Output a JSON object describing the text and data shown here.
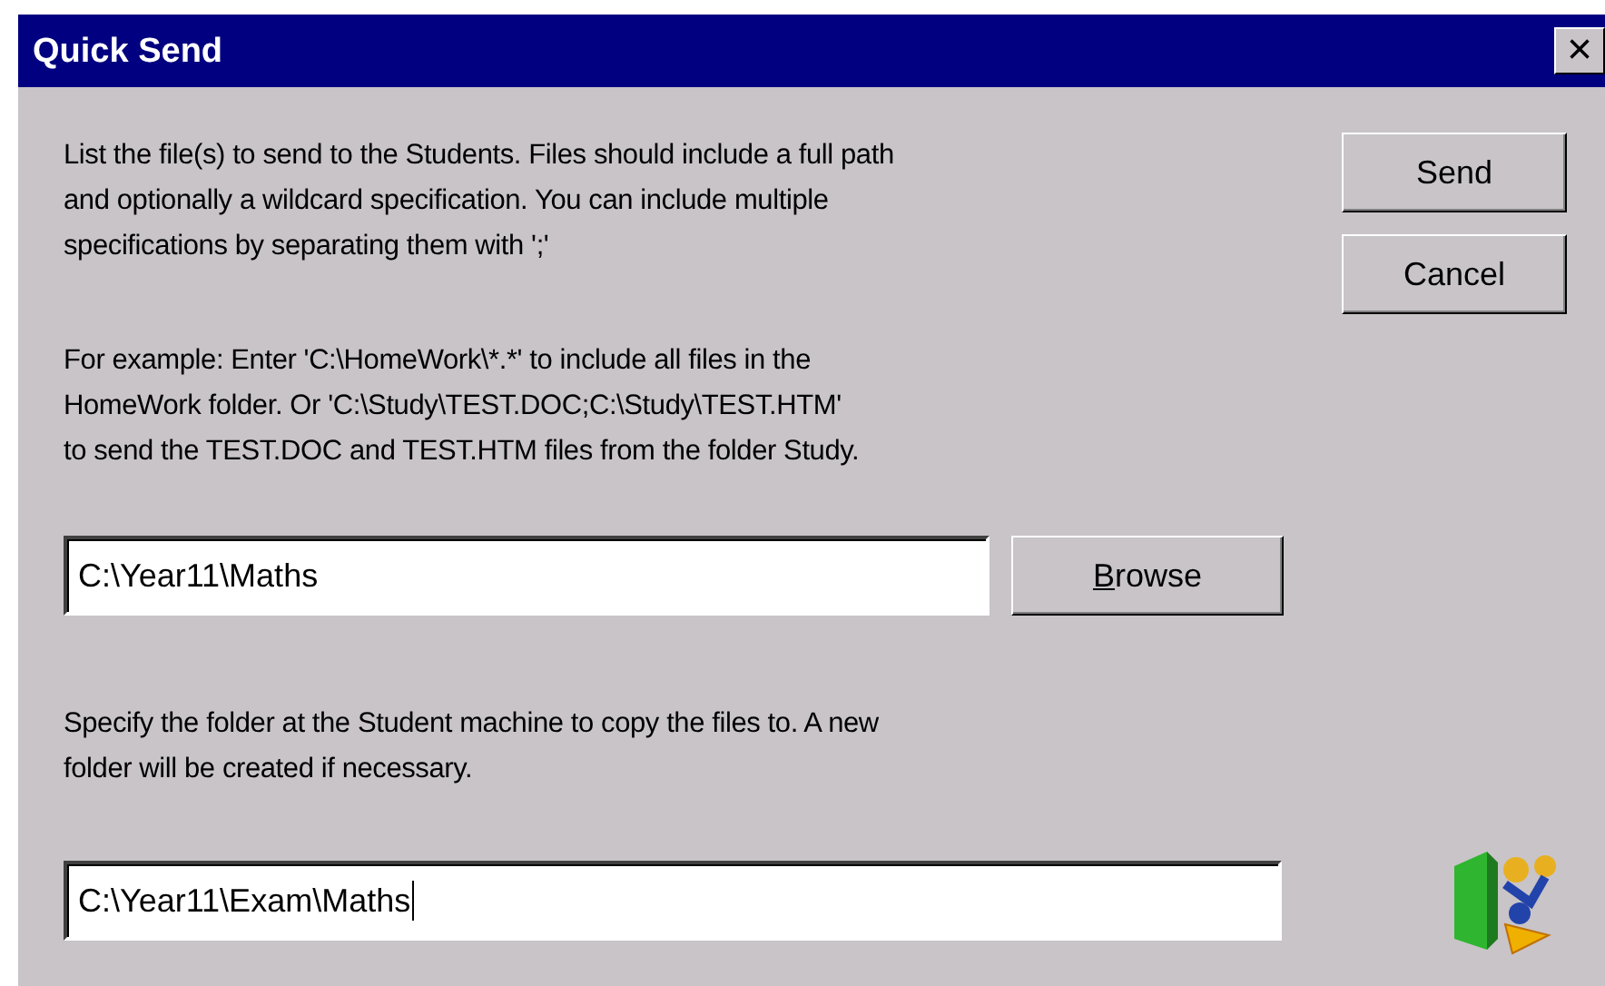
{
  "window": {
    "title": "Quick Send",
    "close": "×"
  },
  "instructions": [
    "List the file(s) to send to the Students. Files should include a full path",
    "and optionally a wildcard specification. You can include multiple",
    "specifications by separating them with ';'"
  ],
  "example": [
    "For example: Enter 'C:\\HomeWork\\*.*' to include all files in the",
    "HomeWork folder. Or 'C:\\Study\\TEST.DOC;C:\\Study\\TEST.HTM'",
    "to send the TEST.DOC and TEST.HTM files from the folder Study."
  ],
  "source_field": {
    "value": "C:\\Year11\\Maths"
  },
  "browse_button": {
    "label": "Browse",
    "underline_first_letter": true
  },
  "destination_note": [
    "Specify the folder at the Student machine to copy the files to. A new",
    "folder will be created if necessary."
  ],
  "destination_field": {
    "value": "C:\\Year11\\Exam\\Maths",
    "focused": true
  },
  "buttons": [
    {
      "label": "Send"
    },
    {
      "label": "Cancel"
    }
  ]
}
